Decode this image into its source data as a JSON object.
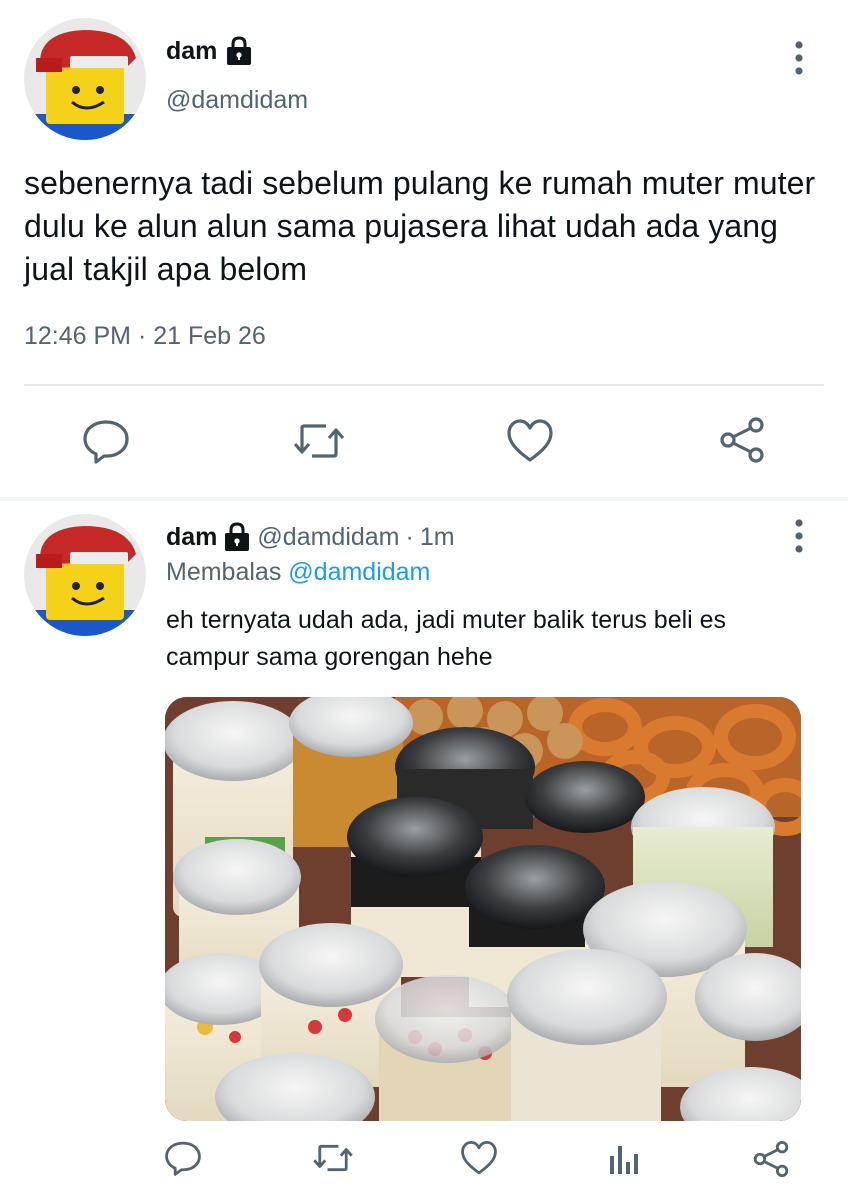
{
  "main_tweet": {
    "display_name": "dam",
    "handle": "@damdidam",
    "text": "sebenernya tadi sebelum pulang ke rumah muter muter dulu ke alun alun sama pujasera lihat udah ada yang jual takjil apa belom",
    "time": "12:46 PM",
    "separator": "·",
    "date": "21 Feb 26",
    "actions": [
      "reply",
      "retweet",
      "like",
      "share"
    ]
  },
  "reply_tweet": {
    "display_name": "dam",
    "handle": "@damdidam",
    "separator": "·",
    "time_ago": "1m",
    "replying_prefix": "Membalas",
    "replying_to": "@damdidam",
    "text": "eh ternyata udah ada, jadi muter balik terus beli es campur sama gorengan hehe",
    "media": {
      "icon": "food-photo",
      "subject": "es campur cups and fried snacks"
    },
    "actions": [
      "reply",
      "retweet",
      "like",
      "views",
      "share"
    ]
  },
  "colors": {
    "text": "#0f1419",
    "secondary": "#536471",
    "link": "#1d9bf0",
    "divider": "#e4e8eb"
  }
}
